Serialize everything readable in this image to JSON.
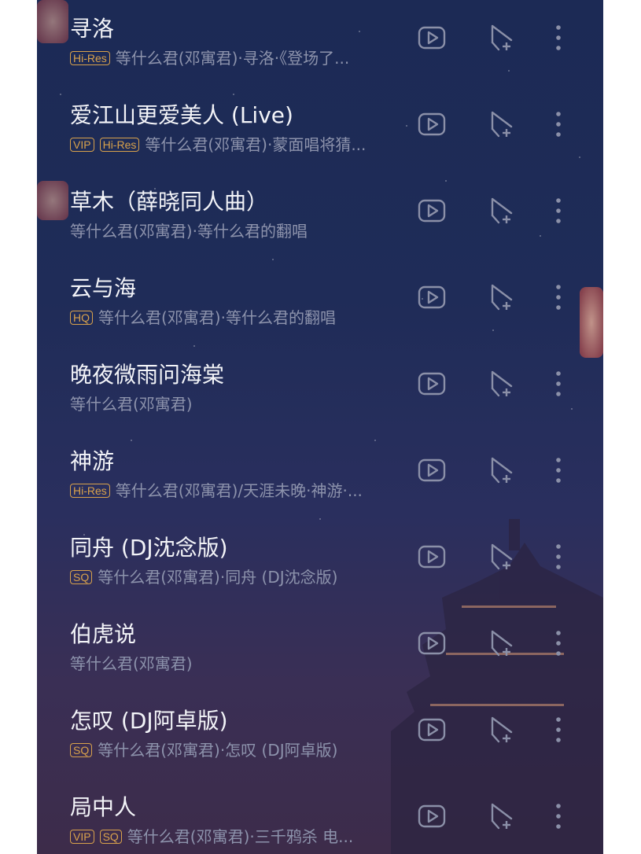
{
  "songs": [
    {
      "title": "寻洛",
      "badges": [
        "Hi-Res"
      ],
      "artist": "等什么君(邓寓君)·寻洛·《登场了..."
    },
    {
      "title": "爱江山更爱美人 (Live)",
      "badges": [
        "VIP",
        "Hi-Res"
      ],
      "artist": "等什么君(邓寓君)·蒙面唱将猜..."
    },
    {
      "title": "草木（薛晓同人曲）",
      "badges": [],
      "artist": "等什么君(邓寓君)·等什么君的翻唱"
    },
    {
      "title": "云与海",
      "badges": [
        "HQ"
      ],
      "artist": "等什么君(邓寓君)·等什么君的翻唱"
    },
    {
      "title": "晚夜微雨问海棠",
      "badges": [],
      "artist": "等什么君(邓寓君)"
    },
    {
      "title": "神游",
      "badges": [
        "Hi-Res"
      ],
      "artist": "等什么君(邓寓君)/天涯未晚·神游·..."
    },
    {
      "title": "同舟 (DJ沈念版)",
      "badges": [
        "SQ"
      ],
      "artist": "等什么君(邓寓君)·同舟 (DJ沈念版)"
    },
    {
      "title": "伯虎说",
      "badges": [],
      "artist": "等什么君(邓寓君)"
    },
    {
      "title": "怎叹 (DJ阿卓版)",
      "badges": [
        "SQ"
      ],
      "artist": "等什么君(邓寓君)·怎叹 (DJ阿卓版)"
    },
    {
      "title": "局中人",
      "badges": [
        "VIP",
        "SQ"
      ],
      "artist": "等什么君(邓寓君)·三千鸦杀 电..."
    }
  ],
  "icons": {
    "video": "video-play-icon",
    "add": "add-to-playlist-icon",
    "more": "more-vertical-icon"
  },
  "colors": {
    "background_top": "#1c2a55",
    "background_bottom": "#3d2c4a",
    "title_text": "#f3f4f8",
    "subtitle_text": "#8d93ac",
    "badge_gold": "#d9a24c",
    "icon_gray": "#8b90a8"
  }
}
